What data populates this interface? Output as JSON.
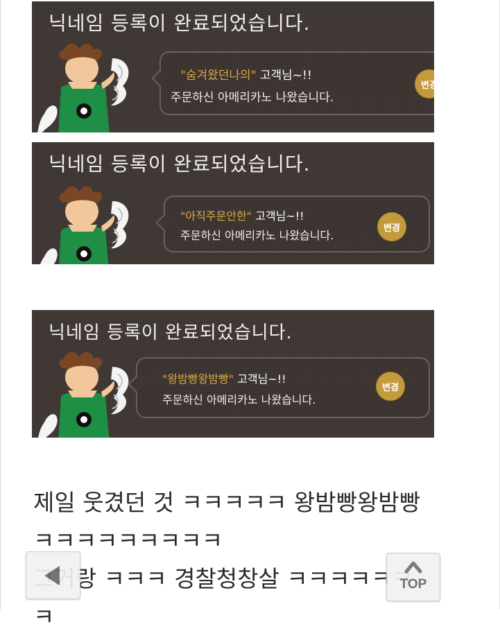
{
  "cards": [
    {
      "heading": "닉네임 등록이 완료되었습니다.",
      "nickname": "\"숨겨왔던나의\"",
      "honorific": "고객님~!!",
      "message": "주문하신 아메리카노 나왔습니다.",
      "button_label": "변경"
    },
    {
      "heading": "닉네임 등록이 완료되었습니다.",
      "nickname": "\"아직주문안한\"",
      "honorific": "고객님~!!",
      "message": "주문하신 아메리카노 나왔습니다.",
      "button_label": "변경"
    },
    {
      "heading": "닉네임 등록이 완료되었습니다.",
      "nickname": "\"왕밤빵왕밤빵\"",
      "honorific": "고객님~!!",
      "message": "주문하신 아메리카노 나왔습니다.",
      "button_label": "변경"
    }
  ],
  "comment": {
    "line1": "제일 웃겼던 것 ㅋㅋㅋㅋㅋ 왕밤빵왕밤빵",
    "line2": "ㅋㅋㅋㅋㅋㅋㅋㅋㅋ",
    "line3": "그거랑 ㅋㅋㅋ 경찰청창살 ㅋㅋㅋㅋㅋㅋ",
    "line4": "ㅋ"
  },
  "nav": {
    "top_label": "TOP",
    "back_icon": "back-arrow-icon",
    "top_icon": "chevron-up-icon"
  },
  "colors": {
    "card_bg": "#3f3733",
    "nickname": "#d8a942",
    "button": "#c49b3c",
    "apron": "#1f8f45"
  }
}
